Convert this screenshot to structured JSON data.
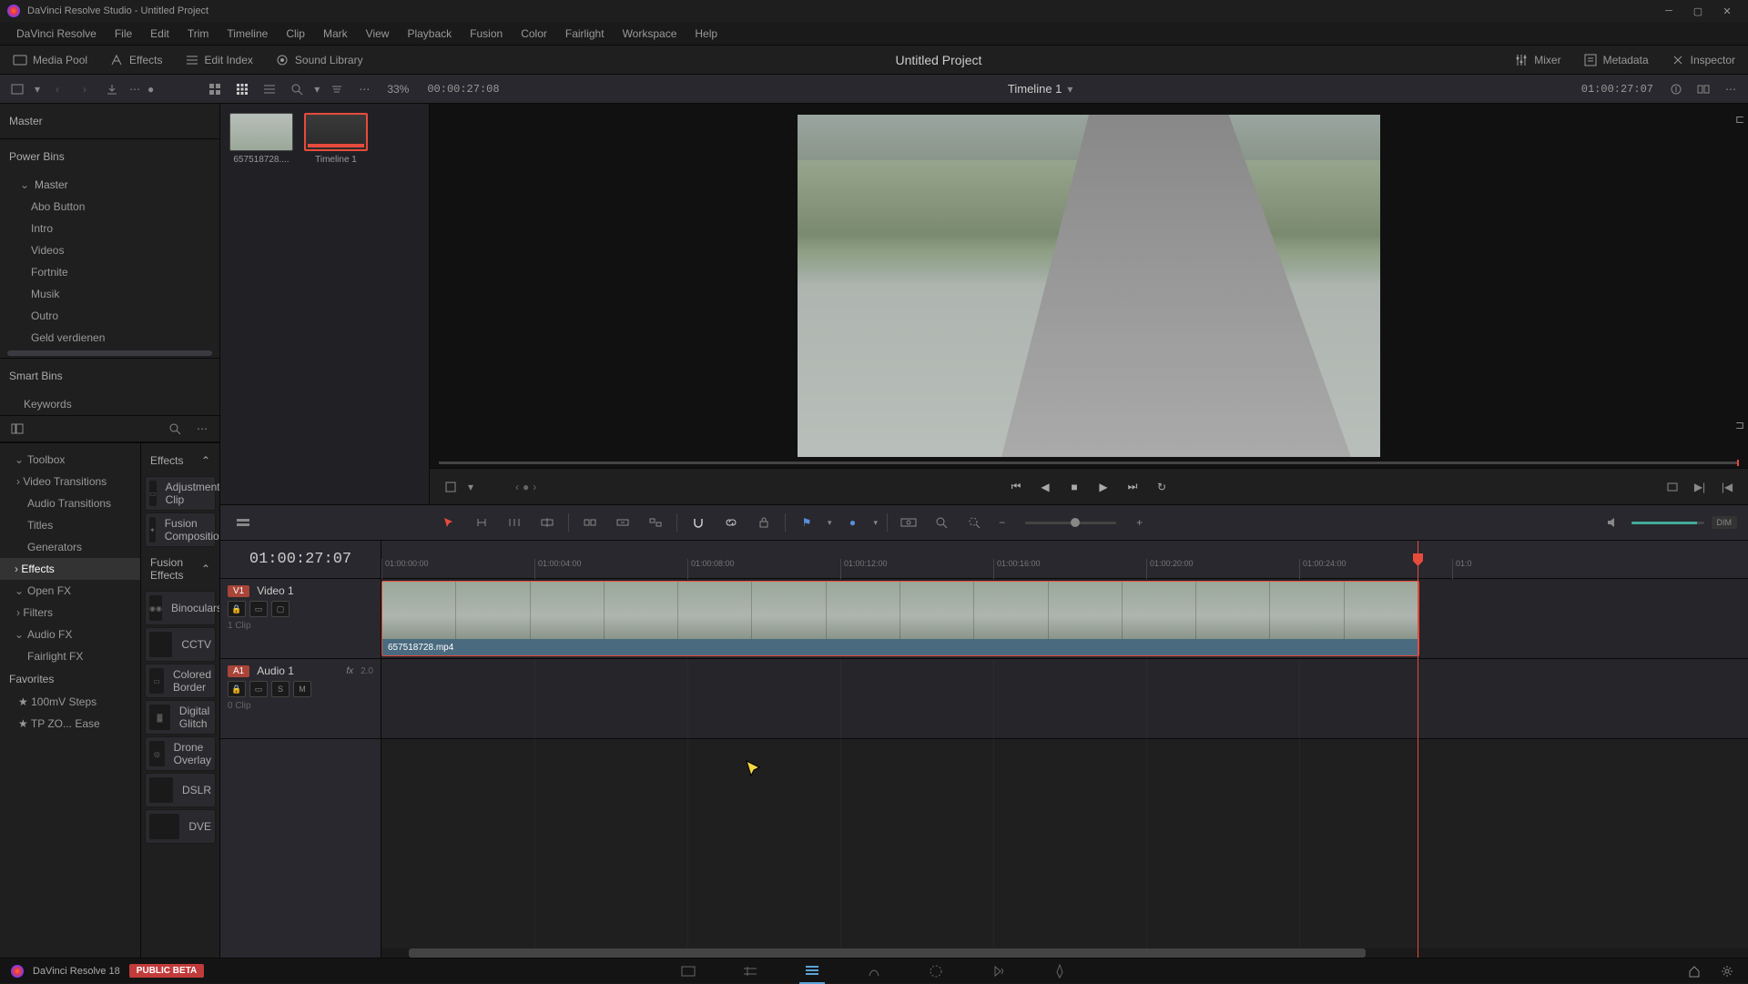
{
  "titlebar": {
    "title": "DaVinci Resolve Studio - Untitled Project"
  },
  "menu": [
    "DaVinci Resolve",
    "File",
    "Edit",
    "Trim",
    "Timeline",
    "Clip",
    "Mark",
    "View",
    "Playback",
    "Fusion",
    "Color",
    "Fairlight",
    "Workspace",
    "Help"
  ],
  "toolbar": {
    "media_pool": "Media Pool",
    "effects": "Effects",
    "edit_index": "Edit Index",
    "sound_library": "Sound Library",
    "mixer": "Mixer",
    "metadata": "Metadata",
    "inspector": "Inspector",
    "project_title": "Untitled Project"
  },
  "subbar": {
    "zoom": "33%",
    "timecode_src": "00:00:27:08",
    "timeline_name": "Timeline 1",
    "timecode_tl": "01:00:27:07"
  },
  "bins": {
    "master": "Master",
    "power_bins": "Power Bins",
    "power_master": "Master",
    "power_items": [
      "Abo Button",
      "Intro",
      "Videos",
      "Fortnite",
      "Musik",
      "Outro",
      "Geld verdienen"
    ],
    "smart_bins": "Smart Bins",
    "smart_items": [
      "Keywords"
    ]
  },
  "media": {
    "clip1": "657518728....",
    "clip2": "Timeline 1"
  },
  "fx_tree": {
    "toolbox": "Toolbox",
    "toolbox_items": [
      "Video Transitions",
      "Audio Transitions",
      "Titles",
      "Generators",
      "Effects"
    ],
    "openfx": "Open FX",
    "openfx_items": [
      "Filters"
    ],
    "audiofx": "Audio FX",
    "audiofx_items": [
      "Fairlight FX"
    ],
    "favorites": "Favorites",
    "fav_items": [
      "100mV Steps",
      "TP ZO... Ease"
    ]
  },
  "fx_list": {
    "effects_header": "Effects",
    "effects_items": [
      "Adjustment Clip",
      "Fusion Composition"
    ],
    "fusion_header": "Fusion Effects",
    "fusion_items": [
      "Binoculars",
      "CCTV",
      "Colored Border",
      "Digital Glitch",
      "Drone Overlay",
      "DSLR",
      "DVE"
    ]
  },
  "timeline": {
    "tc_display": "01:00:27:07",
    "ruler_ticks": [
      "01:00:00:00",
      "01:00:04:00",
      "01:00:08:00",
      "01:00:12:00",
      "01:00:16:00",
      "01:00:20:00",
      "01:00:24:00",
      "01:0"
    ],
    "v1_badge": "V1",
    "v1_name": "Video 1",
    "v1_clips": "1 Clip",
    "a1_badge": "A1",
    "a1_name": "Audio 1",
    "a1_fx": "fx",
    "a1_level": "2.0",
    "a1_clips": "0 Clip",
    "a1_s": "S",
    "a1_m": "M",
    "clip_name": "657518728.mp4",
    "dim": "DIM"
  },
  "bottom": {
    "version": "DaVinci Resolve 18",
    "beta": "PUBLIC BETA"
  }
}
